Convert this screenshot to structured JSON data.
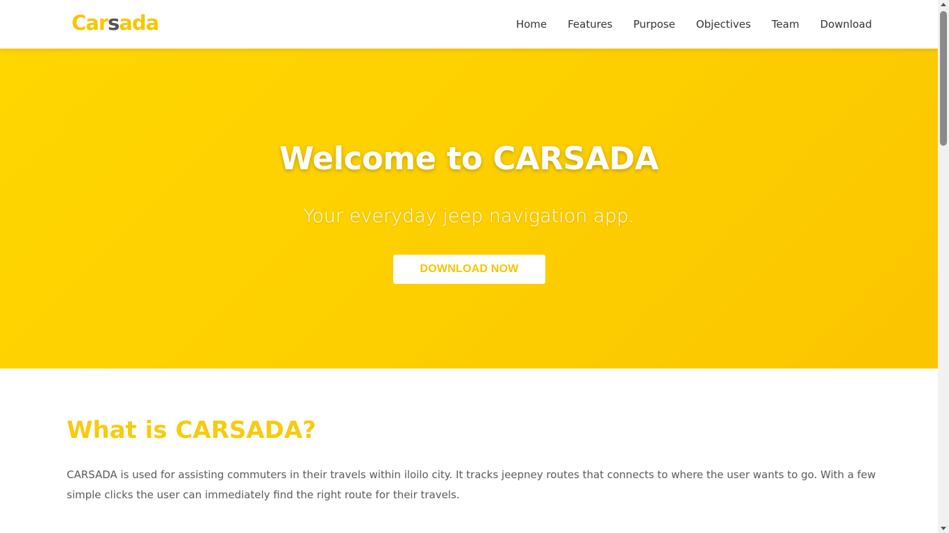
{
  "logo": {
    "part1": "Car",
    "part2": "s",
    "part3": "ada"
  },
  "nav": {
    "items": [
      "Home",
      "Features",
      "Purpose",
      "Objectives",
      "Team",
      "Download"
    ]
  },
  "hero": {
    "title": "Welcome to CARSADA",
    "subtitle": "Your everyday jeep navigation app.",
    "button_label": "DOWNLOAD NOW"
  },
  "about": {
    "title": "What is CARSADA?",
    "text": "CARSADA is used for assisting commuters in their travels within iloilo city. It tracks jeepney routes that connects to where the user wants to go. With a few simple clicks the user can immediately find the right route for their travels."
  },
  "colors": {
    "brand_yellow": "#fdcf00",
    "heading_yellow": "#f7cb0e",
    "nav_text": "#333333"
  }
}
